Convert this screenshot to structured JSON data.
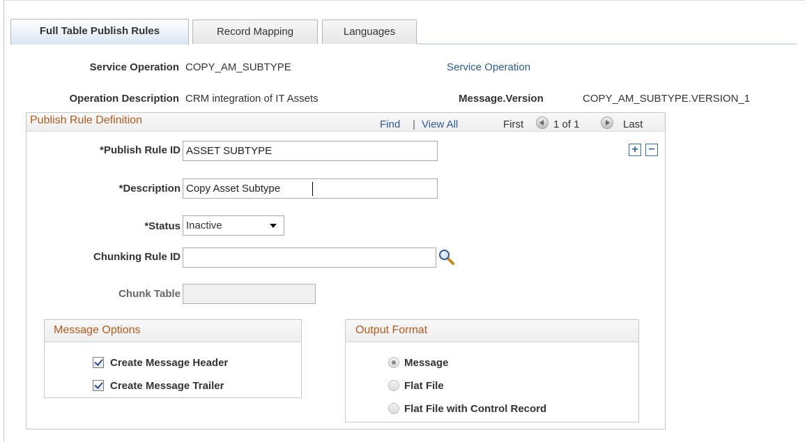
{
  "tabs": [
    {
      "label": "Full Table Publish Rules",
      "active": true
    },
    {
      "label": "Record Mapping",
      "active": false
    },
    {
      "label": "Languages",
      "active": false
    }
  ],
  "header": {
    "service_operation_label": "Service Operation",
    "service_operation_value": "COPY_AM_SUBTYPE",
    "service_operation_link": "Service Operation",
    "operation_description_label": "Operation Description",
    "operation_description_value": "CRM integration of IT Assets",
    "message_version_label": "Message.Version",
    "message_version_value": "COPY_AM_SUBTYPE.VERSION_1"
  },
  "publish_rule": {
    "title": "Publish Rule Definition",
    "find": "Find",
    "separator": "|",
    "view_all": "View All",
    "first": "First",
    "counter": "1 of 1",
    "last": "Last",
    "add_button": "+",
    "delete_button": "−",
    "publish_rule_id_label": "*Publish Rule ID",
    "publish_rule_id_value": "ASSET SUBTYPE",
    "description_label": "*Description",
    "description_value": "Copy Asset Subtype",
    "status_label": "*Status",
    "status_value": "Inactive",
    "chunking_rule_id_label": "Chunking Rule ID",
    "chunking_rule_id_value": "",
    "chunk_table_label": "Chunk Table",
    "chunk_table_value": ""
  },
  "message_options": {
    "title": "Message Options",
    "items": [
      {
        "label": "Create Message Header",
        "checked": true
      },
      {
        "label": "Create Message Trailer",
        "checked": true
      }
    ]
  },
  "output_format": {
    "title": "Output Format",
    "options": [
      {
        "label": "Message",
        "selected": true
      },
      {
        "label": "Flat File",
        "selected": false
      },
      {
        "label": "Flat File with Control Record",
        "selected": false
      }
    ]
  },
  "colors": {
    "link": "#2a5a9e",
    "group_title": "#b35a1e",
    "row_button": "#2f6db5"
  }
}
